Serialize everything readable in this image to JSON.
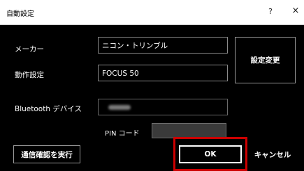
{
  "window": {
    "title": "自動設定",
    "help": "?",
    "close": "×"
  },
  "labels": {
    "maker": "メーカー",
    "operation": "動作設定",
    "bluetooth": "Bluetooth デバイス",
    "pin": "PIN コード"
  },
  "fields": {
    "maker_value": "ニコン・トリンブル",
    "operation_value": "FOCUS 50",
    "bluetooth_value": "",
    "pin_value": ""
  },
  "buttons": {
    "change_settings": "設定変更",
    "connection_test": "通信確認を実行",
    "ok": "OK",
    "cancel": "キャンセル"
  },
  "colors": {
    "dialog_background": "#000000",
    "highlight": "#cc0000"
  }
}
